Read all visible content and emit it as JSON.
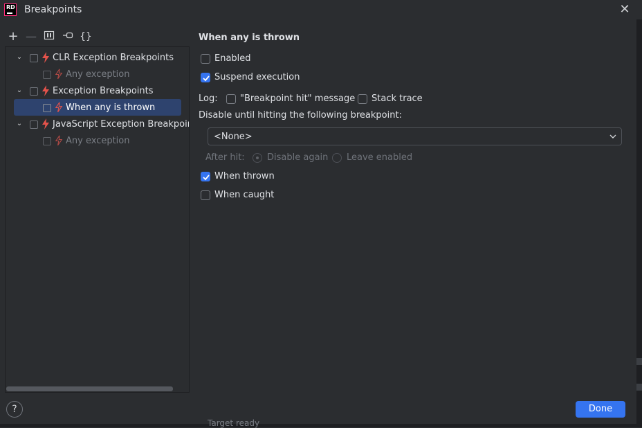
{
  "window": {
    "title": "Breakpoints",
    "logo_text": "RD",
    "close_icon": "close-icon"
  },
  "toolbar": {
    "add_glyph": "+",
    "remove_glyph": "—",
    "group_glyph": "[▮]",
    "toggle_glyph": "⊷",
    "braces_glyph": "{}"
  },
  "tree": {
    "items": [
      {
        "label": "CLR Exception Breakpoints",
        "level": 0,
        "expanded": true,
        "checked": false,
        "dim": false
      },
      {
        "label": "Any exception",
        "level": 1,
        "checked": false,
        "dim": true
      },
      {
        "label": "Exception Breakpoints",
        "level": 0,
        "expanded": true,
        "checked": false,
        "dim": false
      },
      {
        "label": "When any is thrown",
        "level": 1,
        "checked": false,
        "dim": false,
        "selected": true
      },
      {
        "label": "JavaScript Exception Breakpoints",
        "level": 0,
        "expanded": true,
        "checked": false,
        "dim": false
      },
      {
        "label": "Any exception",
        "level": 1,
        "checked": false,
        "dim": true
      }
    ]
  },
  "details": {
    "title": "When any is thrown",
    "enabled_label": "Enabled",
    "enabled_checked": false,
    "suspend_label": "Suspend execution",
    "suspend_checked": true,
    "log_label": "Log:",
    "log_message_label": "\"Breakpoint hit\" message",
    "log_message_checked": false,
    "stack_trace_label": "Stack trace",
    "stack_trace_checked": false,
    "disable_until_label": "Disable until hitting the following breakpoint:",
    "combo_value": "<None>",
    "after_hit_label": "After hit:",
    "disable_again_label": "Disable again",
    "leave_enabled_label": "Leave enabled",
    "when_thrown_label": "When thrown",
    "when_thrown_checked": true,
    "when_caught_label": "When caught",
    "when_caught_checked": false
  },
  "footer": {
    "help_glyph": "?",
    "done_label": "Done"
  },
  "background": {
    "partial_text": "Target ready"
  },
  "colors": {
    "accent": "#3574f0",
    "selection": "#2e436e",
    "bolt": "#e5534b",
    "background": "#2b2d30"
  }
}
